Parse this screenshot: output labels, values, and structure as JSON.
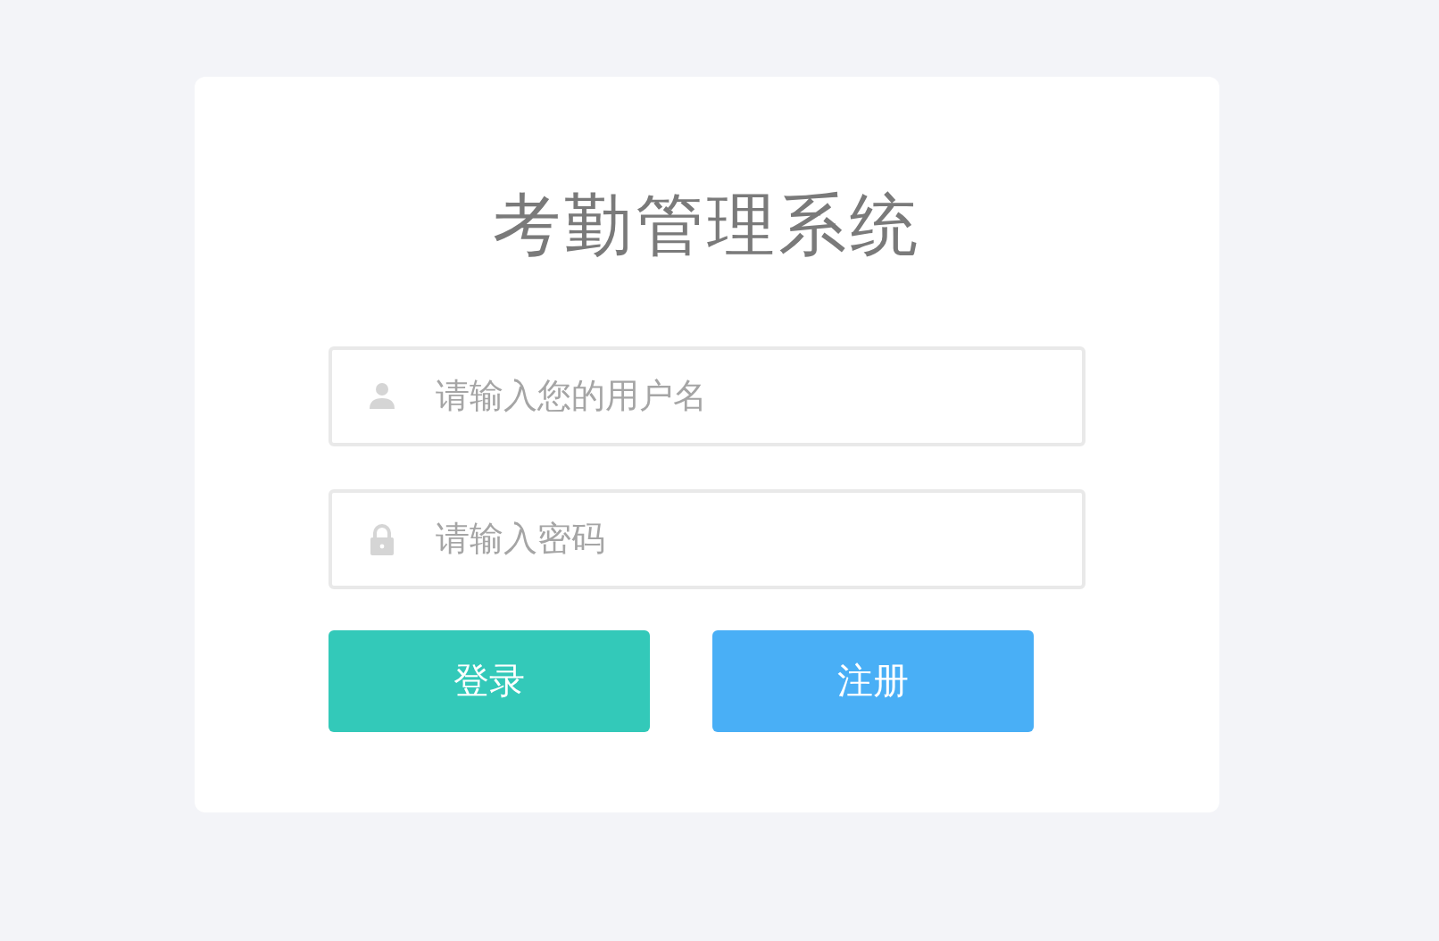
{
  "title": "考勤管理系统",
  "fields": [
    {
      "kind": "user",
      "placeholder": "请输入您的用户名"
    },
    {
      "kind": "password",
      "placeholder": "请输入密码"
    }
  ],
  "buttons": [
    {
      "kind": "primary",
      "label": "登录"
    },
    {
      "kind": "secondary",
      "label": "注册"
    }
  ]
}
